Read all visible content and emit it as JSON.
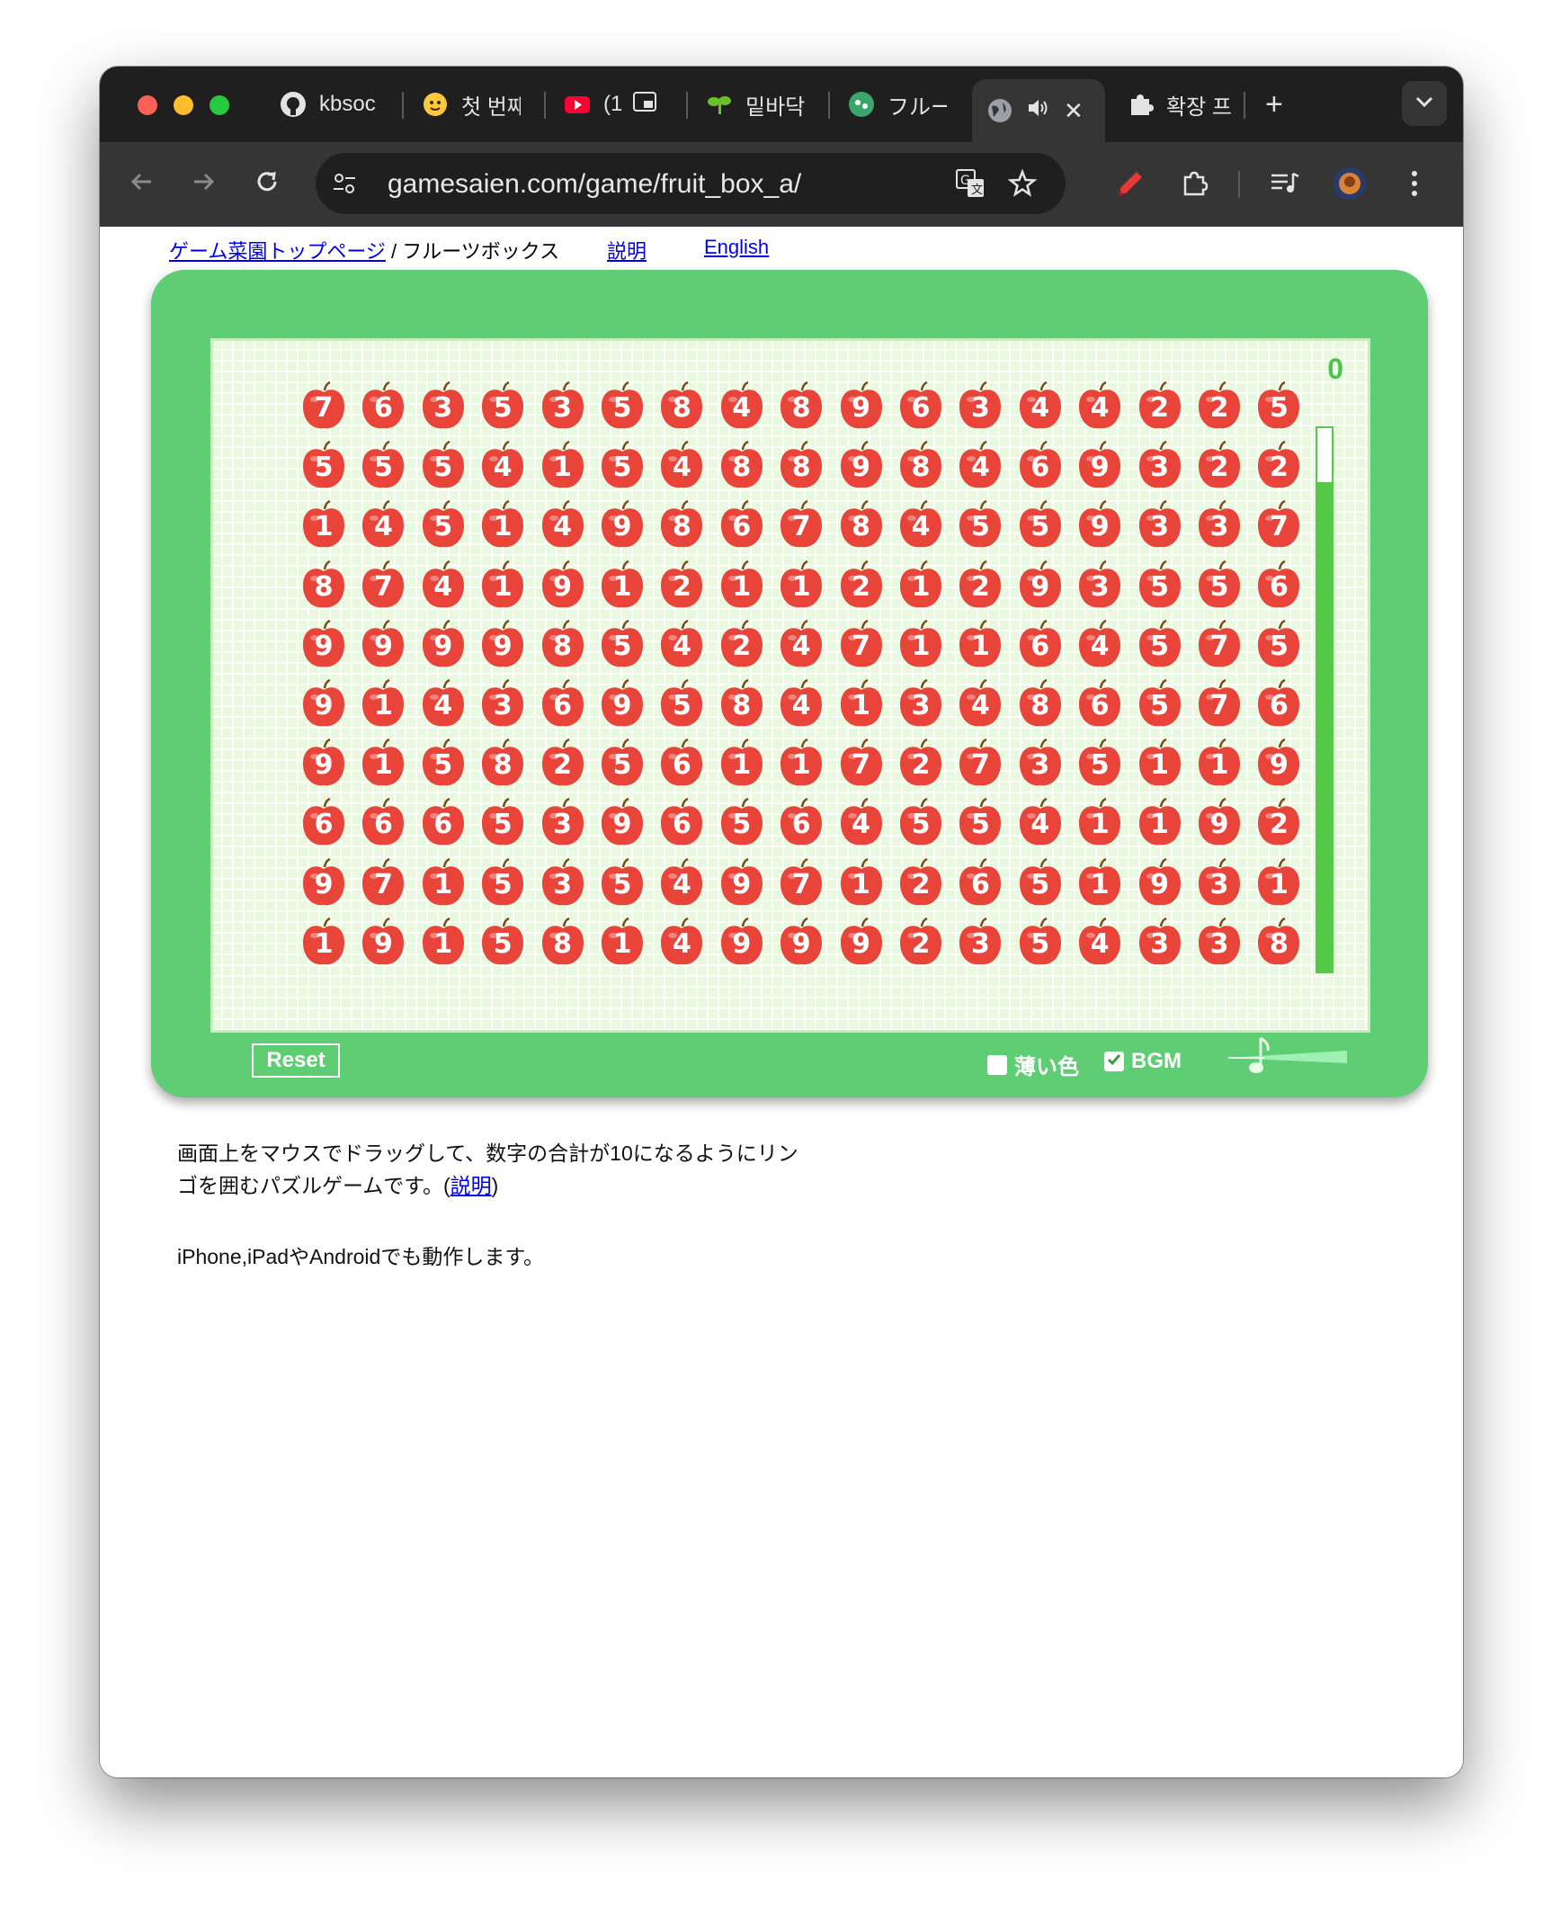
{
  "browser": {
    "tabs": [
      {
        "label": "kbsoc",
        "icon": "github-icon"
      },
      {
        "label": "첫 번째",
        "icon": "hugging-face-icon"
      },
      {
        "label": "(1",
        "icon": "youtube-icon"
      },
      {
        "label": "밑바닥",
        "icon": "sprout-icon"
      },
      {
        "label": "フルー",
        "icon": "game-icon"
      },
      {
        "label": "",
        "icon": "globe-icon",
        "active": true
      },
      {
        "label": "확장 프",
        "icon": "puzzle-icon"
      }
    ],
    "url": "gamesaien.com/game/fruit_box_a/"
  },
  "page": {
    "breadcrumb_home": "ゲーム菜園トップページ",
    "breadcrumb_sep": " / ",
    "breadcrumb_current": "フルーツボックス",
    "help_link": "説明",
    "english_link": "English",
    "description_line1": "画面上をマウスでドラッグして、数字の合計が10になるようにリン",
    "description_line2_prefix": "ゴを囲むパズルゲームです。(",
    "description_link": "説明",
    "description_line2_suffix": ")",
    "description2": "iPhone,iPadやAndroidでも動作します。"
  },
  "game": {
    "score": "0",
    "time_remaining_fraction": 0.9,
    "reset_label": "Reset",
    "light_color_label": "薄い色",
    "light_color_checked": false,
    "bgm_label": "BGM",
    "bgm_checked": true,
    "apple_color": "#e8443a",
    "grid": [
      [
        7,
        6,
        3,
        5,
        3,
        5,
        8,
        4,
        8,
        9,
        6,
        3,
        4,
        4,
        2,
        2,
        5
      ],
      [
        5,
        5,
        5,
        4,
        1,
        5,
        4,
        8,
        8,
        9,
        8,
        4,
        6,
        9,
        3,
        2,
        2
      ],
      [
        1,
        4,
        5,
        1,
        4,
        9,
        8,
        6,
        7,
        8,
        4,
        5,
        5,
        9,
        3,
        3,
        7
      ],
      [
        8,
        7,
        4,
        1,
        9,
        1,
        2,
        1,
        1,
        2,
        1,
        2,
        9,
        3,
        5,
        5,
        6
      ],
      [
        9,
        9,
        9,
        9,
        8,
        5,
        4,
        2,
        4,
        7,
        1,
        1,
        6,
        4,
        5,
        7,
        5
      ],
      [
        9,
        1,
        4,
        3,
        6,
        9,
        5,
        8,
        4,
        1,
        3,
        4,
        8,
        6,
        5,
        7,
        6
      ],
      [
        9,
        1,
        5,
        8,
        2,
        5,
        6,
        1,
        1,
        7,
        2,
        7,
        3,
        5,
        1,
        1,
        9
      ],
      [
        6,
        6,
        6,
        5,
        3,
        9,
        6,
        5,
        6,
        4,
        5,
        5,
        4,
        1,
        1,
        9,
        2
      ],
      [
        9,
        7,
        1,
        5,
        3,
        5,
        4,
        9,
        7,
        1,
        2,
        6,
        5,
        1,
        9,
        3,
        1
      ],
      [
        1,
        9,
        1,
        5,
        8,
        1,
        4,
        9,
        9,
        9,
        2,
        3,
        5,
        4,
        3,
        3,
        8
      ]
    ]
  }
}
